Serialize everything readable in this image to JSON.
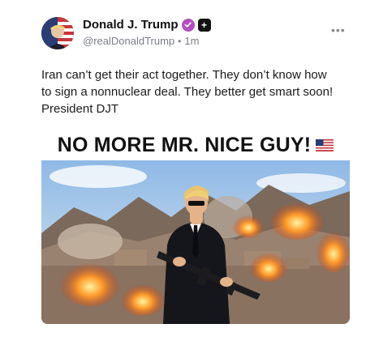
{
  "post": {
    "author_name": "Donald J. Trump",
    "handle": "@realDonaldTrump",
    "separator": "•",
    "timestamp": "1m",
    "verified_icon": "verified-check-icon",
    "plus_icon": "plus-badge-icon",
    "more_icon": "more-options-icon",
    "more_label": "•••",
    "body": "Iran can’t get their act together. They don’t know how to sign a nonnuclear deal. They better get smart soon! President DJT",
    "image": {
      "headline": "NO MORE MR. NICE GUY!",
      "flag_icon": "us-flag-icon"
    }
  },
  "colors": {
    "verified": "#b34fbf",
    "text": "#1b1b1b",
    "muted": "#7b7f86"
  }
}
